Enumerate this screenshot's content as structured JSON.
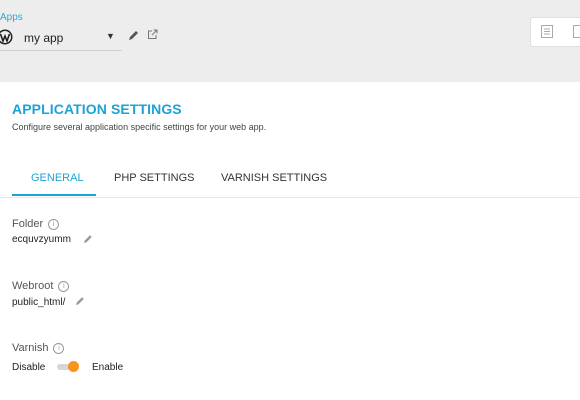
{
  "header": {
    "breadcrumb": "Apps",
    "app_name": "my app",
    "app_icon": "wordpress-icon",
    "caret_icon": "caret-down-icon",
    "edit_icon": "pencil-icon",
    "open_icon": "external-link-icon",
    "view_icons": [
      "list-view-icon",
      "grid-view-icon"
    ]
  },
  "settings": {
    "title": "APPLICATION SETTINGS",
    "description": "Configure several application specific settings for your web app."
  },
  "tabs": [
    {
      "label": "GENERAL",
      "active": true
    },
    {
      "label": "PHP SETTINGS",
      "active": false
    },
    {
      "label": "VARNISH SETTINGS",
      "active": false
    }
  ],
  "fields": {
    "folder": {
      "label": "Folder",
      "value": "ecquvzyumm"
    },
    "webroot": {
      "label": "Webroot",
      "value": "public_html/"
    },
    "varnish": {
      "label": "Varnish",
      "off_label": "Disable",
      "on_label": "Enable",
      "enabled": true
    }
  },
  "colors": {
    "accent": "#1ca3d6",
    "toggle_on": "#f7941d",
    "topbar_bg": "#ededed"
  }
}
